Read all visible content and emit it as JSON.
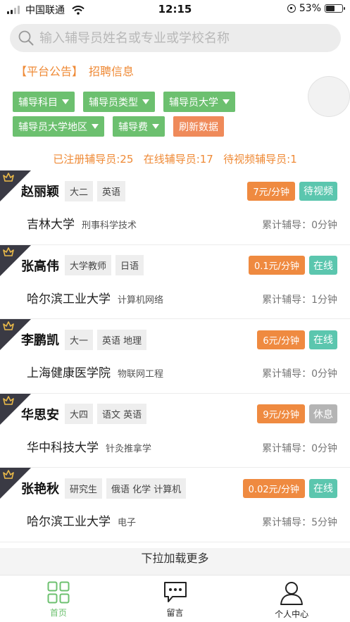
{
  "status_bar": {
    "carrier": "中国联通",
    "time": "12:15",
    "battery": "53%",
    "battery_level": 0.53
  },
  "search": {
    "placeholder": "输入辅导员姓名或专业或学校名称"
  },
  "notice": {
    "platform": "【平台公告】",
    "recruit": "招聘信息"
  },
  "filters": {
    "row1": [
      "辅导科目",
      "辅导员类型",
      "辅导员大学"
    ],
    "row2": [
      "辅导员大学地区",
      "辅导费"
    ],
    "refresh": "刷新数据"
  },
  "stats": "已注册辅导员:25   在线辅导员:17   待视频辅导员:1",
  "tutors": [
    {
      "name": "赵丽颖",
      "grade": "大二",
      "subjects": "英语",
      "price": "7元/分钟",
      "status": "待视频",
      "status_color": "#5bc6ae",
      "school": "吉林大学",
      "major": "刑事科学技术",
      "total": "累计辅导：0分钟"
    },
    {
      "name": "张高伟",
      "grade": "大学教师",
      "subjects": "日语",
      "price": "0.1元/分钟",
      "status": "在线",
      "status_color": "#5bc6ae",
      "school": "哈尔滨工业大学",
      "major": "计算机网络",
      "total": "累计辅导：1分钟"
    },
    {
      "name": "李鹏凯",
      "grade": "大一",
      "subjects": "英语 地理",
      "price": "6元/分钟",
      "status": "在线",
      "status_color": "#5bc6ae",
      "school": "上海健康医学院",
      "major": "物联网工程",
      "total": "累计辅导：0分钟"
    },
    {
      "name": "华思安",
      "grade": "大四",
      "subjects": "语文 英语",
      "price": "9元/分钟",
      "status": "休息",
      "status_color": "#b4b4b4",
      "school": "华中科技大学",
      "major": "针灸推拿学",
      "total": "累计辅导：0分钟"
    },
    {
      "name": "张艳秋",
      "grade": "研究生",
      "subjects": "俄语 化学 计算机",
      "price": "0.02元/分钟",
      "status": "在线",
      "status_color": "#5bc6ae",
      "school": "哈尔滨工业大学",
      "major": "电子",
      "total": "累计辅导：5分钟"
    }
  ],
  "load_more": "下拉加载更多",
  "tabbar": [
    {
      "label": "首页",
      "icon": "home-grid-icon",
      "active": true
    },
    {
      "label": "留言",
      "icon": "message-icon",
      "active": false
    },
    {
      "label": "个人中心",
      "icon": "profile-icon",
      "active": false
    }
  ],
  "colors": {
    "accent_green": "#6cc06f",
    "accent_orange": "#ef8a36",
    "tab_active": "#6cc06f"
  }
}
